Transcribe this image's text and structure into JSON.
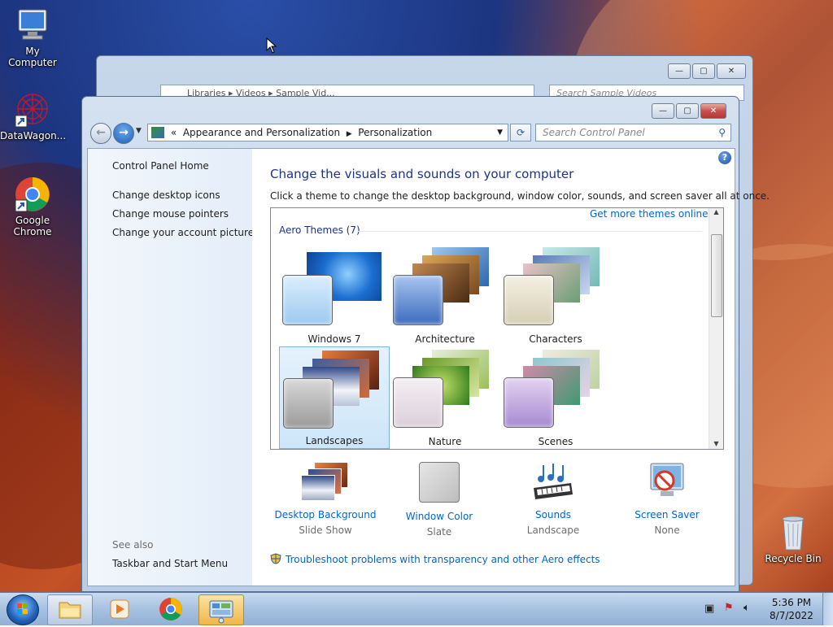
{
  "desktop": {
    "icons": [
      {
        "label": "My Computer",
        "icon": "computer-icon"
      },
      {
        "label": "DataWagon...",
        "icon": "datawagon-shortcut-icon"
      },
      {
        "label": "Google Chrome",
        "icon": "chrome-icon"
      },
      {
        "label": "Recycle Bin",
        "icon": "recycle-bin-icon"
      }
    ]
  },
  "back_window": {
    "breadcrumb": [
      "Libraries",
      "Videos",
      "Sample Vid..."
    ],
    "search_placeholder": "Search Sample Videos"
  },
  "window": {
    "breadcrumb_prefix": "«",
    "breadcrumb": [
      "Appearance and Personalization",
      "Personalization"
    ],
    "search_placeholder": "Search Control Panel",
    "help_glyph": "?"
  },
  "sidebar": {
    "home": "Control Panel Home",
    "links": [
      "Change desktop icons",
      "Change mouse pointers",
      "Change your account picture"
    ],
    "see_also_title": "See also",
    "see_also_links": [
      "Taskbar and Start Menu"
    ]
  },
  "content": {
    "heading": "Change the visuals and sounds on your computer",
    "subtitle": "Click a theme to change the desktop background, window color, sounds, and screen saver all at once.",
    "get_more_link": "Get more themes online",
    "group_title": "Aero Themes (7)",
    "themes": [
      {
        "name": "Windows 7",
        "selected": false
      },
      {
        "name": "Architecture",
        "selected": false
      },
      {
        "name": "Characters",
        "selected": false
      },
      {
        "name": "Landscapes",
        "selected": true
      },
      {
        "name": "Nature",
        "selected": false
      },
      {
        "name": "Scenes",
        "selected": false
      }
    ],
    "bottom": [
      {
        "label": "Desktop Background",
        "value": "Slide Show",
        "icon": "desktop-background-icon"
      },
      {
        "label": "Window Color",
        "value": "Slate",
        "icon": "window-color-icon"
      },
      {
        "label": "Sounds",
        "value": "Landscape",
        "icon": "sounds-icon"
      },
      {
        "label": "Screen Saver",
        "value": "None",
        "icon": "screen-saver-icon"
      }
    ],
    "troubleshoot_link": "Troubleshoot problems with transparency and other Aero effects"
  },
  "taskbar": {
    "time": "5:36 PM",
    "date": "8/7/2022",
    "pinned": [
      "start-orb",
      "explorer",
      "media-player",
      "chrome",
      "control-panel"
    ]
  },
  "colors": {
    "link": "#0066cc",
    "heading": "#1e3287",
    "selection": "#cde6fa"
  }
}
